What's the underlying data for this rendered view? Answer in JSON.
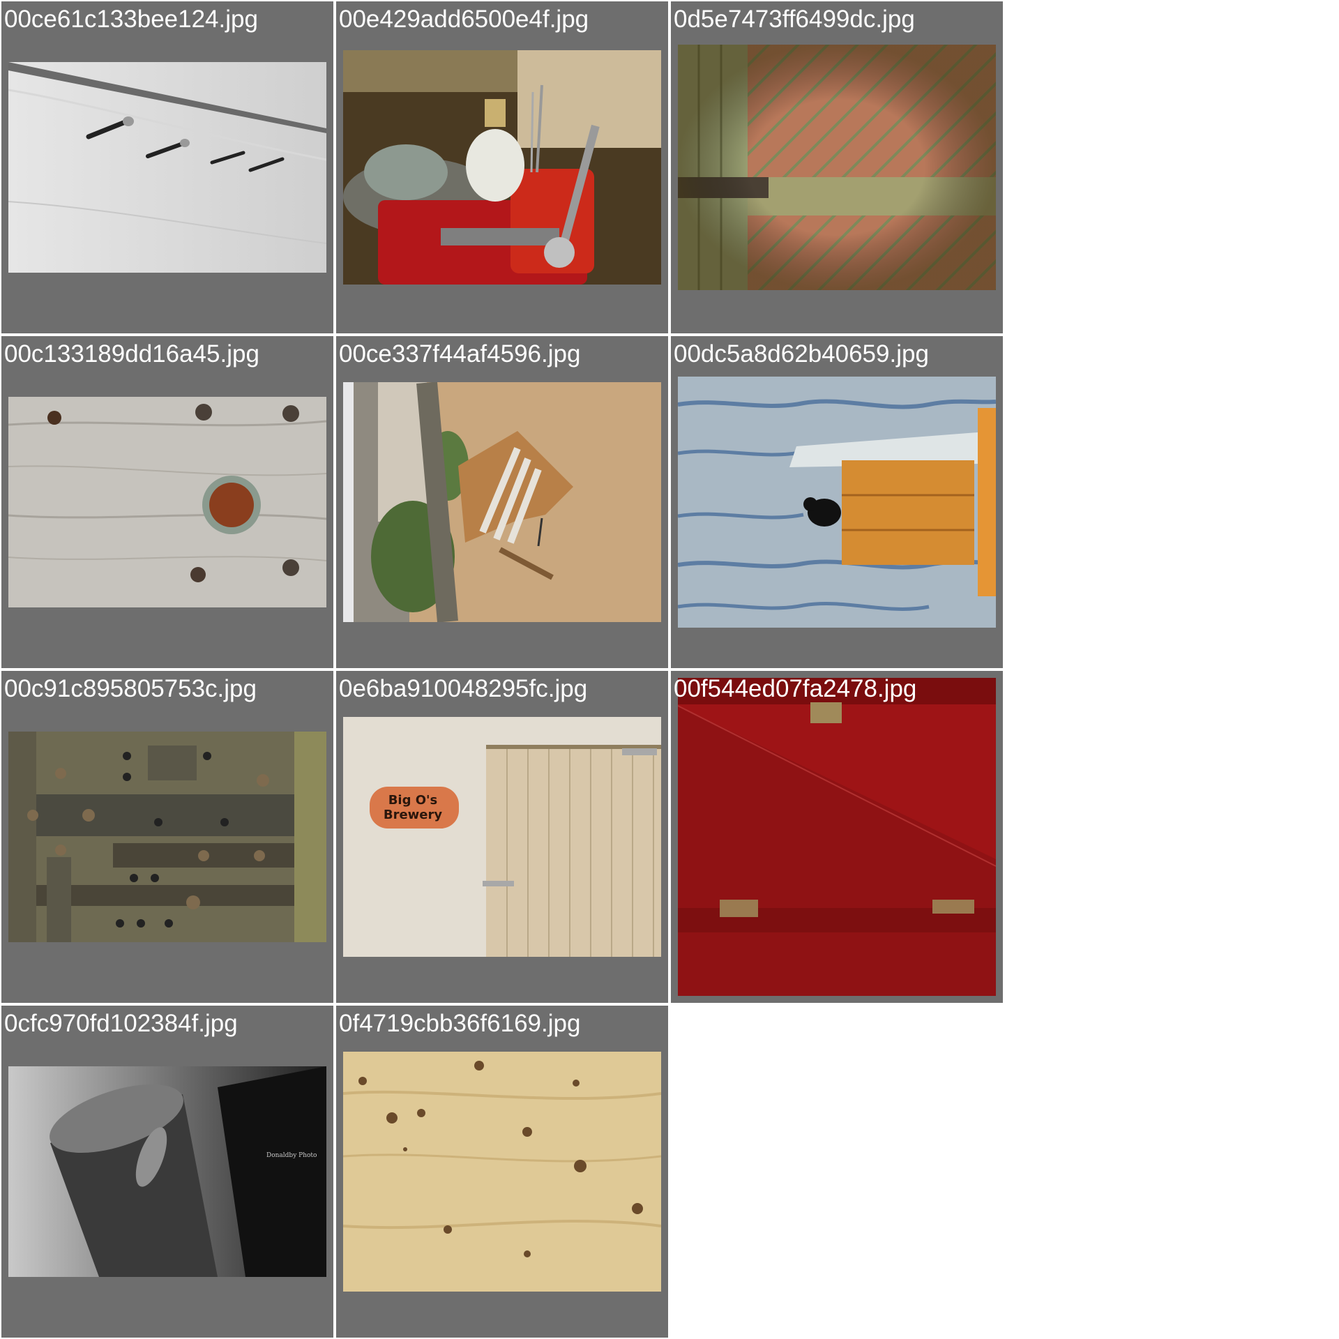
{
  "gallery": {
    "items": [
      {
        "filename": "00ce61c133bee124.jpg",
        "icon": "nails-in-wood-photo"
      },
      {
        "filename": "00e429add6500e4f.jpg",
        "icon": "vise-lightbulb-photo"
      },
      {
        "filename": "0d5e7473ff6499dc.jpg",
        "icon": "barn-door-photo"
      },
      {
        "filename": "00c133189dd16a45.jpg",
        "icon": "bolted-wood-photo"
      },
      {
        "filename": "00ce337f44af4596.jpg",
        "icon": "garden-chair-photo"
      },
      {
        "filename": "00dc5a8d62b40659.jpg",
        "icon": "birdhouse-crow-photo"
      },
      {
        "filename": "00c91c895805753c.jpg",
        "icon": "rusty-iron-door-photo"
      },
      {
        "filename": "0e6ba910048295fc.jpg",
        "icon": "brewery-door-photo",
        "sign_line1": "Big O's",
        "sign_line2": "Brewery"
      },
      {
        "filename": "00f544ed07fa2478.jpg",
        "icon": "red-box-photo"
      },
      {
        "filename": "0cfc970fd102384f.jpg",
        "icon": "cicada-stump-photo",
        "watermark": "Donaldby Photo"
      },
      {
        "filename": "0f4719cbb36f6169.jpg",
        "icon": "plywood-photo"
      }
    ]
  },
  "colors": {
    "cell_background": "#6e6e6e",
    "page_background": "#ffffff",
    "label_text": "#ffffff"
  }
}
